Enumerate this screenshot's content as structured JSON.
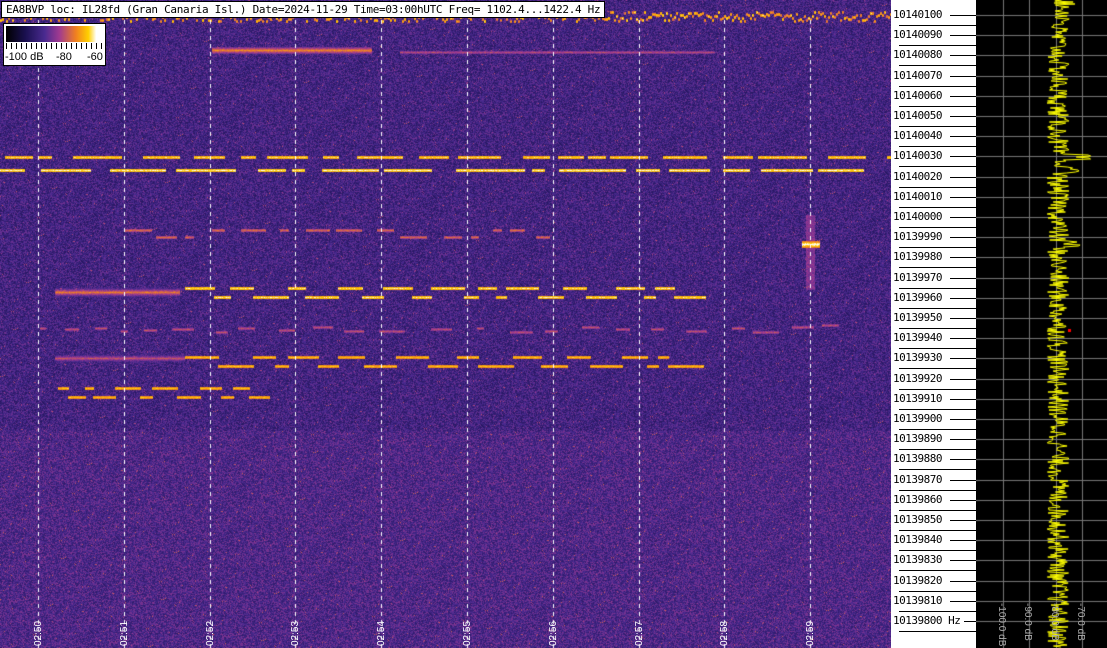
{
  "header": {
    "title": "EA8BVP loc: IL28fd (Gran Canaria Isl.) Date=2024-11-29 Time=03:00hUTC Freq= 1102.4...1422.4 Hz"
  },
  "colorbar": {
    "labels": [
      "-100 dB",
      "-80",
      "-60"
    ],
    "colormap": [
      "#000000",
      "#1a1050",
      "#4a2a90",
      "#a03a90",
      "#f08020",
      "#ffd000",
      "#ffffff"
    ]
  },
  "chart_data": {
    "type": "heatmap",
    "title": "EA8BVP loc: IL28fd (Gran Canaria Isl.) Date=2024-11-29 Time=03:00hUTC Freq= 1102.4...1422.4 Hz",
    "x_ticks": [
      "02:50",
      "02:51",
      "02:52",
      "02:53",
      "02:54",
      "02:55",
      "02:56",
      "02:57",
      "02:58",
      "02:59"
    ],
    "y_ticks": [
      "10140100",
      "10140090",
      "10140080",
      "10140070",
      "10140060",
      "10140050",
      "10140040",
      "10140030",
      "10140020",
      "10140010",
      "10140000",
      "10139990",
      "10139980",
      "10139970",
      "10139960",
      "10139950",
      "10139940",
      "10139930",
      "10139920",
      "10139910",
      "10139900",
      "10139890",
      "10139880",
      "10139870",
      "10139860",
      "10139850",
      "10139840",
      "10139830",
      "10139820",
      "10139810",
      "10139800"
    ],
    "y_unit": "Hz",
    "ylim": [
      10139800,
      10140100
    ],
    "color_scale_db": [
      -100,
      -60
    ],
    "grid": true,
    "spectrum_panel": {
      "x_ticks": [
        "-100.0 dB",
        "-90.0 dB",
        "-80.0 dB",
        "-70.0 dB"
      ],
      "trace_color": "#ffff00"
    }
  }
}
